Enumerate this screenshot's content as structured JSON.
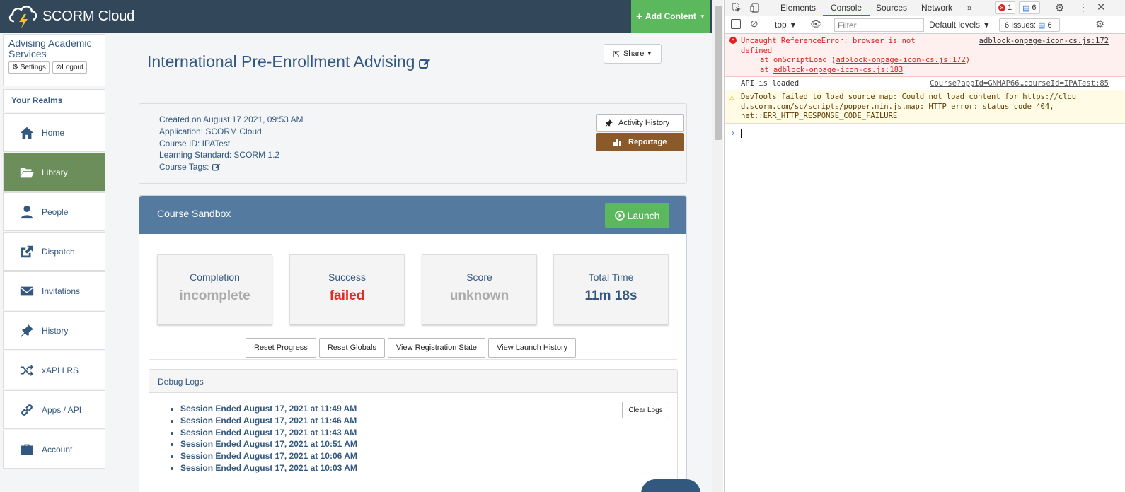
{
  "app": {
    "logo_text": "SCORM Cloud",
    "add_content_label": "Add Content",
    "colors": {
      "header": "#33475b",
      "accent_green": "#5cb85c",
      "nav_active": "#6b8e5b",
      "link_blue": "#33587f",
      "reportage": "#8b5a2b"
    }
  },
  "sidebar": {
    "account_name": "Advising Academic Services",
    "settings_label": "Settings",
    "logout_label": "Logout",
    "realms_label": "Your Realms",
    "items": [
      {
        "label": "Home",
        "icon": "home-icon"
      },
      {
        "label": "Library",
        "icon": "folder-open-icon"
      },
      {
        "label": "People",
        "icon": "user-icon"
      },
      {
        "label": "Dispatch",
        "icon": "share-box-icon"
      },
      {
        "label": "Invitations",
        "icon": "envelope-icon"
      },
      {
        "label": "History",
        "icon": "pin-icon"
      },
      {
        "label": "xAPI LRS",
        "icon": "shuffle-icon"
      },
      {
        "label": "Apps / API",
        "icon": "link-icon"
      },
      {
        "label": "Account",
        "icon": "briefcase-icon"
      }
    ],
    "active_item": "Library"
  },
  "course": {
    "title": "International Pre-Enrollment Advising",
    "share_label": "Share",
    "info": {
      "created": "Created on August 17 2021, 09:53 AM",
      "application": "Application: SCORM Cloud",
      "course_id": "Course ID: IPATest",
      "standard": "Learning Standard: SCORM 1.2",
      "tags": "Course Tags:"
    },
    "activity_history_label": "Activity History",
    "reportage_label": "Reportage"
  },
  "sandbox": {
    "title": "Course Sandbox",
    "launch_label": "Launch",
    "stats": [
      {
        "label": "Completion",
        "value": "incomplete",
        "color": "#aaaaaa"
      },
      {
        "label": "Success",
        "value": "failed",
        "color": "#e02b20"
      },
      {
        "label": "Score",
        "value": "unknown",
        "color": "#aaaaaa"
      },
      {
        "label": "Total Time",
        "value": "11m 18s",
        "color": "#33587f"
      }
    ],
    "actions": [
      "Reset Progress",
      "Reset Globals",
      "View Registration State",
      "View Launch History"
    ],
    "debug_title": "Debug Logs",
    "clear_logs_label": "Clear Logs",
    "logs": [
      "Session Ended August 17, 2021 at 11:49 AM",
      "Session Ended August 17, 2021 at 11:46 AM",
      "Session Ended August 17, 2021 at 11:43 AM",
      "Session Ended August 17, 2021 at 10:51 AM",
      "Session Ended August 17, 2021 at 10:06 AM",
      "Session Ended August 17, 2021 at 10:03 AM"
    ]
  },
  "devtools": {
    "tabs": [
      "Elements",
      "Console",
      "Sources",
      "Network"
    ],
    "active_tab": "Console",
    "error_count": "1",
    "message_count": "6",
    "context": "top",
    "filter_placeholder": "Filter",
    "levels": "Default levels",
    "issues": "6 Issues:",
    "issues_count": "6",
    "messages": {
      "error_line1": "Uncaught ReferenceError: browser is not",
      "error_line2": "defined",
      "error_line3a": "at onScriptLoad (",
      "error_line3b": "adblock-onpage-icon-cs.js:172",
      "error_line3c": ")",
      "error_line4a": "at ",
      "error_line4b": "adblock-onpage-icon-cs.js:183",
      "error_src": "adblock-onpage-icon-cs.js:172",
      "log_text": "API is loaded",
      "log_src": "Course?appId=GNMAP66…courseId=IPATest:85",
      "warn_line1a": "DevTools failed to load source map: Could not load content for ",
      "warn_line1b": "https://clou",
      "warn_line2a": "d.scorm.com/sc/scripts/popper.min.js.map",
      "warn_line2b": ": HTTP error: status code 404,",
      "warn_line3": "net::ERR_HTTP_RESPONSE_CODE_FAILURE"
    }
  }
}
